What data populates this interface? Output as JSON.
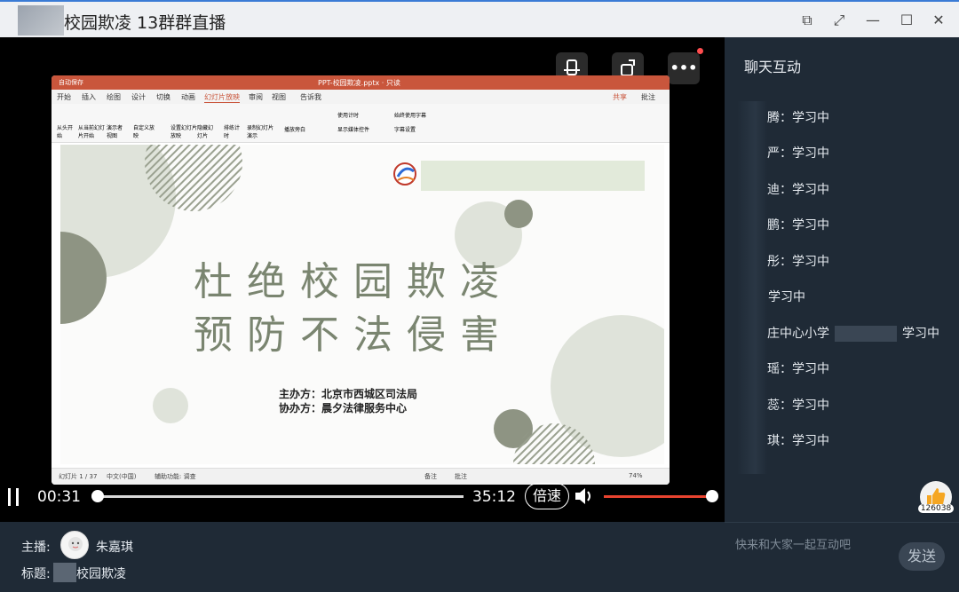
{
  "window": {
    "title": "校园欺凌 13群群直播",
    "buttons": {
      "pip": "⧉",
      "fullscreen": "⤢",
      "minimize": "—",
      "maximize": "☐",
      "close": "✕"
    }
  },
  "top_tools": {
    "screen": "📱",
    "rotate": "⟳",
    "more": "•••"
  },
  "ppt": {
    "app_title": "PPT-校园欺凌.pptx · 只读",
    "autosave": "自动保存",
    "tabs": [
      "开始",
      "插入",
      "绘图",
      "设计",
      "切换",
      "动画",
      "幻灯片放映",
      "审阅",
      "视图",
      "告诉我"
    ],
    "active_tab": "幻灯片放映",
    "share": "共享",
    "comment": "批注",
    "ribbon": [
      {
        "label": "从头开始"
      },
      {
        "label": "从当前幻灯片开始"
      },
      {
        "label": "演示者视图"
      },
      {
        "label": "自定义放映"
      },
      {
        "label": "设置幻灯片放映"
      },
      {
        "label": "隐藏幻灯片"
      },
      {
        "label": "排练计时"
      },
      {
        "label": "录制幻灯片演示"
      }
    ],
    "ribbon_text": [
      "播放旁白",
      "使用计时",
      "显示媒体控件",
      "始终使用字幕",
      "字幕设置"
    ],
    "status_left": "幻灯片 1 / 37",
    "status_lang": "中文(中国)",
    "status_access": "辅助功能: 调查",
    "status_notes": "备注",
    "status_comments": "批注",
    "zoom": "74%"
  },
  "slide": {
    "line1": "杜绝校园欺凌",
    "line2": "预防不法侵害",
    "host_label": "主办方：北京市西城区司法局",
    "coop_label": "协办方：晨夕法律服务中心",
    "accent": "#7a8570"
  },
  "player": {
    "current_time": "00:31",
    "total_time": "35:12",
    "speed_label": "倍速",
    "progress": 0.015,
    "volume": 1.0,
    "pause_icon": "pause-icon",
    "volume_icon": "volume-icon"
  },
  "info": {
    "anchor_label": "主播:",
    "anchor_name": "朱嘉琪",
    "subject_label": "标题:",
    "subject": "校园欺凌"
  },
  "chat": {
    "title": "聊天互动",
    "items": [
      {
        "name": "腾",
        "msg": "：学习中"
      },
      {
        "name": "严",
        "msg": "：学习中"
      },
      {
        "name": "迪",
        "msg": "：学习中"
      },
      {
        "name": "鹏",
        "msg": "：学习中"
      },
      {
        "name": "彤",
        "msg": "：学习中"
      },
      {
        "name": "",
        "msg": "学习中"
      },
      {
        "name": "庄中心小学",
        "msg": "学习中"
      },
      {
        "name": "瑶",
        "msg": "：学习中"
      },
      {
        "name": "蕊",
        "msg": "：学习中"
      },
      {
        "name": "琪",
        "msg": "：学习中"
      }
    ],
    "like_count": "126038",
    "input_placeholder": "快来和大家一起互动吧",
    "send_label": "发送"
  },
  "colors": {
    "chat_bg": "#1f2a36",
    "progress": "#e8432f",
    "slide_green": "#7a8570"
  }
}
